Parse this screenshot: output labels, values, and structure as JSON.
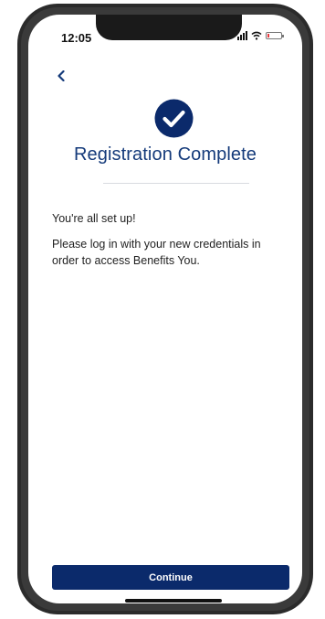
{
  "status_bar": {
    "time": "12:05",
    "battery_level": 0.15,
    "battery_color": "#e8383d"
  },
  "nav": {
    "back_icon": "chevron-left-icon"
  },
  "header": {
    "status_icon": "check-circle-icon",
    "title": "Registration Complete"
  },
  "body": {
    "message_1": "You're all set up!",
    "message_2": "Please log in with your new credentials in order to access Benefits You."
  },
  "footer": {
    "continue_label": "Continue"
  },
  "colors": {
    "brand": "#143a7a",
    "button": "#0b2a6b"
  }
}
